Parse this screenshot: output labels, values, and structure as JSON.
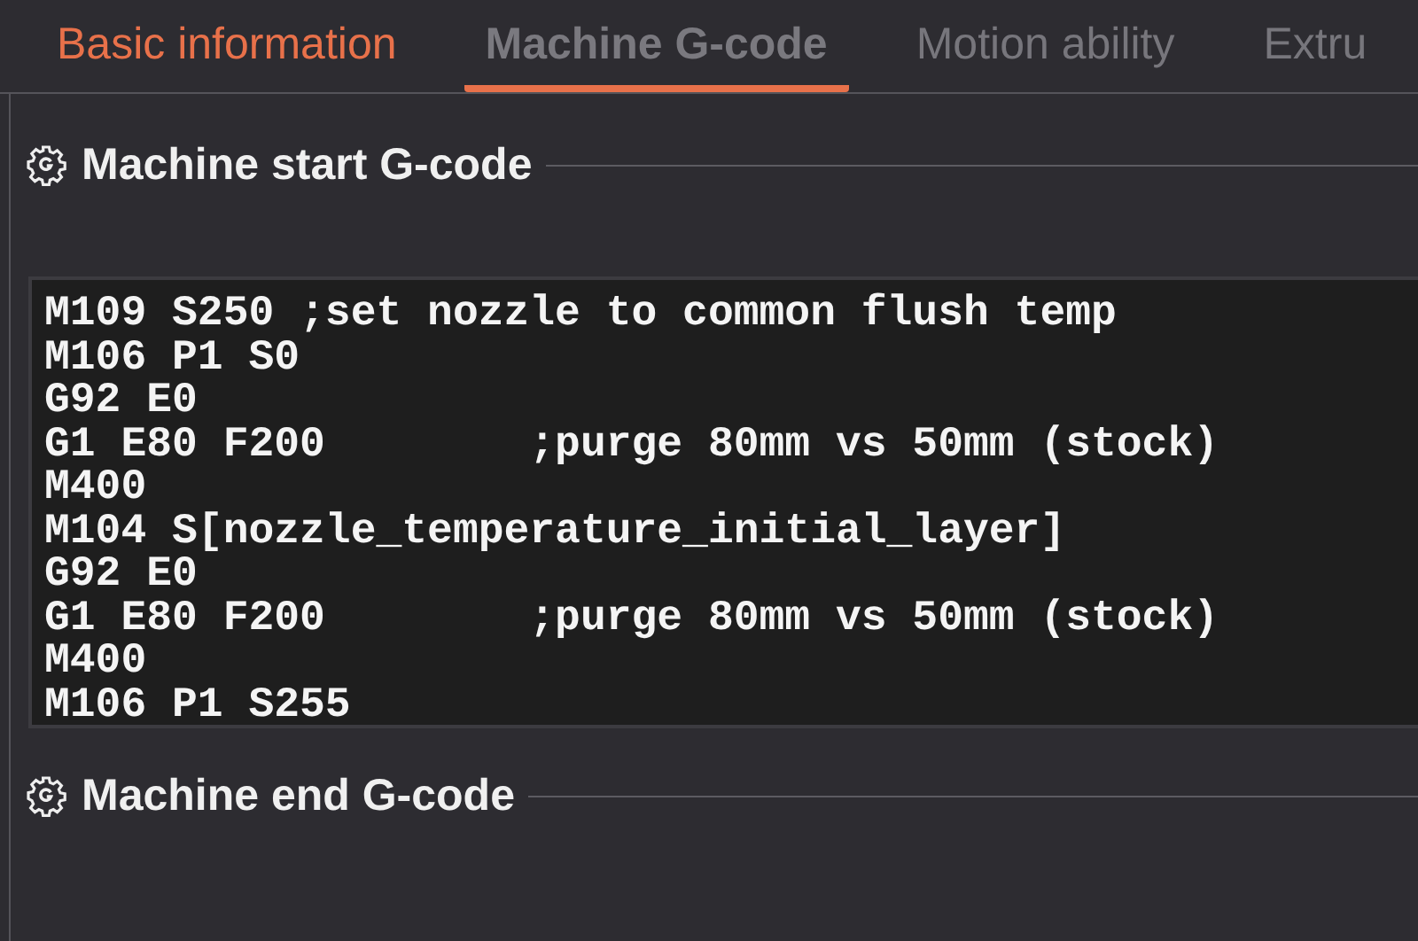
{
  "tabs": [
    {
      "label": "Basic information",
      "selected": false,
      "hovered": true
    },
    {
      "label": "Machine G-code",
      "selected": true,
      "hovered": false
    },
    {
      "label": "Motion ability",
      "selected": false,
      "hovered": false
    },
    {
      "label": "Extru",
      "selected": false,
      "hovered": false
    }
  ],
  "sections": [
    {
      "title": "Machine start G-code",
      "code_lines": [
        "M109 S250 ;set nozzle to common flush temp",
        "M106 P1 S0",
        "G92 E0",
        "G1 E80 F200        ;purge 80mm vs 50mm (stock)",
        "M400",
        "M104 S[nozzle_temperature_initial_layer]",
        "G92 E0",
        "G1 E80 F200        ;purge 80mm vs 50mm (stock)",
        "M400",
        "M106 P1 S255"
      ]
    },
    {
      "title": "Machine end G-code"
    }
  ]
}
